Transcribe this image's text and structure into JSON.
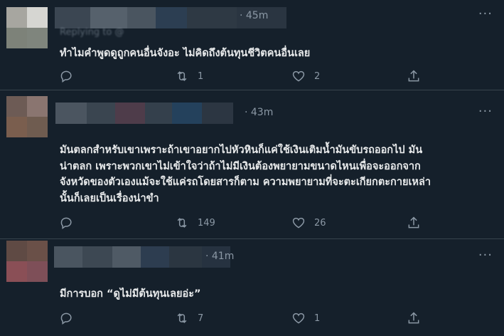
{
  "tweets": [
    {
      "timestamp": "· 45m",
      "replying": "Replying to @",
      "text": [
        "ทำไมคำพูดดูถูกคนอื่นจังอะ ไม่คิดถึงต้นทุนชีวิตคนอื่นเลย"
      ],
      "reply_count": "",
      "retweet_count": "1",
      "like_count": "2"
    },
    {
      "timestamp": "· 43m",
      "text": [
        "มันตลกสำหรับเขาเพราะถ้าเขาอยากไปหัวหินก็แค่ใช้เงินเติมน้ำมันขับรถออกไป  มัน",
        "น่าตลก  เพราะพวกเขาไม่เข้าใจว่าถ้าไม่มีเงินต้องพยายามขนาดไหนเพื่อจะออกจาก",
        "จังหวัดของตัวเองแม้จะใช้แค่รถโดยสารก็ตาม ความพยายามที่จะตะเกียกตะกายเหล่า",
        "นั้นก็เลยเป็นเรื่องน่าขำ"
      ],
      "reply_count": "",
      "retweet_count": "149",
      "like_count": "26"
    },
    {
      "timestamp": "· 41m",
      "text": [
        "มีการบอก “ดูไม่มีต้นทุนเลยอ่ะ”"
      ],
      "reply_count": "",
      "retweet_count": "7",
      "like_count": "1"
    }
  ],
  "icons": [
    "reply-icon",
    "retweet-icon",
    "like-icon",
    "share-icon",
    "more-icon"
  ],
  "colors": {
    "background": "#15202b",
    "divider": "#38444d",
    "text": "#e7e9ea",
    "muted": "#8b98a5"
  }
}
